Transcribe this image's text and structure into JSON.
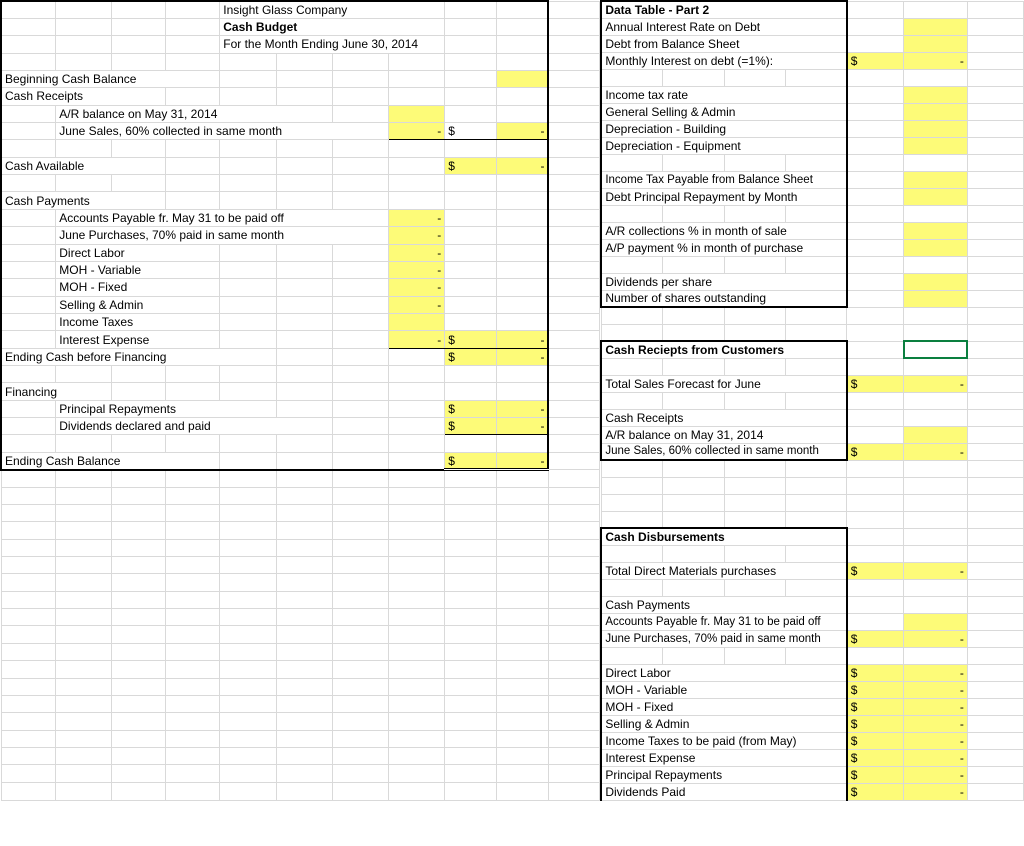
{
  "left": {
    "company": "Insight Glass Company",
    "title": "Cash Budget",
    "period": "For the Month Ending June 30, 2014",
    "begin_cash": "Beginning Cash Balance",
    "receipts": "Cash Receipts",
    "ar_may31": "A/R balance on May 31, 2014",
    "june60": "June Sales, 60% collected in same month",
    "d": "$",
    "dash": "-",
    "cash_avail": "Cash Available",
    "payments": "Cash Payments",
    "ap_may31": "Accounts Payable fr. May 31 to be paid off",
    "june70": "June Purchases, 70% paid in same month",
    "dl": "Direct Labor",
    "moh_v": "MOH - Variable",
    "moh_f": "MOH - Fixed",
    "sa": "Selling & Admin",
    "itax": "Income Taxes",
    "iexp": "Interest Expense",
    "end_before": "Ending Cash before Financing",
    "fin": "Financing",
    "prin": "Principal Repayments",
    "divp": "Dividends declared and paid",
    "end_bal": "Ending Cash Balance"
  },
  "right": {
    "dt2": "Data Table - Part 2",
    "airod": "Annual Interest Rate on Debt",
    "dbs": "Debt from Balance Sheet",
    "mio": "Monthly Interest on debt (=1%):",
    "d": "$",
    "dash": "-",
    "itr": "Income tax rate",
    "gsa": "General Selling & Admin",
    "dep_b": " Depreciation - Building",
    "dep_e": " Depreciation - Equipment",
    "itp": "Income Tax Payable from Balance Sheet",
    "dprm": "Debt Principal Repayment by Month",
    "arc": "A/R collections % in month of sale",
    "app": "A/P payment % in month of purchase",
    "dps": "Dividends per share",
    "nso": "Number of shares outstanding",
    "crfc": "Cash Reciepts from Customers",
    "tsf": "Total Sales Forecast for June",
    "cr": "Cash Receipts",
    "ar_may31": "A/R balance on May 31, 2014",
    "june60": "June Sales, 60% collected in same month",
    "cd": "Cash Disbursements",
    "tdm": "Total Direct Materials purchases",
    "cp": "Cash Payments",
    "ap_may31": "Accounts Payable fr. May 31 to be paid off",
    "june70": "June Purchases, 70% paid in same month",
    "dl": "Direct Labor",
    "moh_v": "MOH - Variable",
    "moh_f": "MOH - Fixed",
    "sa": "Selling & Admin",
    "itmay": "Income Taxes to be paid (from May)",
    "iexp": "Interest Expense",
    "prin": "Principal Repayments",
    "divp": "Dividends Paid"
  }
}
